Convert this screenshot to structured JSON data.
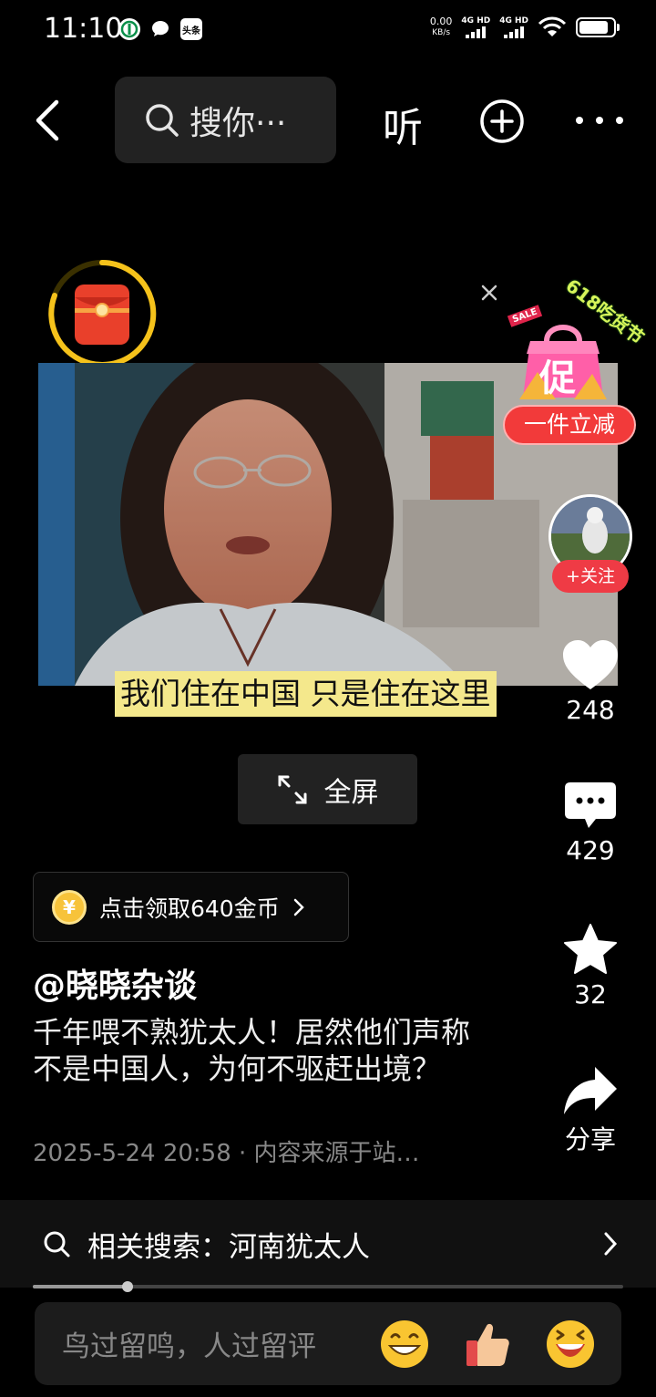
{
  "status_bar": {
    "time": "11:10",
    "net_speed_value": "0.00",
    "net_speed_unit": "KB/s",
    "sim1": "4G HD",
    "sim2": "4G HD",
    "battery_level": 0.85,
    "app_icons": [
      "bank-app-icon",
      "chat-app-icon",
      "toutiao-app-icon"
    ],
    "toutiao_label": "头条"
  },
  "top_nav": {
    "search_text": "搜你···",
    "listen_label": "听"
  },
  "video": {
    "subtitle": "我们住在中国 只是住在这里"
  },
  "promo": {
    "event_label": "618吃货节",
    "sale_tag": "SALE",
    "bag_label": "促",
    "pill_label": "一件立减"
  },
  "side_actions": {
    "follow_label": "+关注",
    "likes": "248",
    "comments": "429",
    "favorites": "32",
    "share_label": "分享"
  },
  "fullscreen_label": "全屏",
  "coin_reward": {
    "label": "点击领取640金币",
    "coin_symbol": "¥"
  },
  "post": {
    "author": "@晓晓杂谈",
    "description": "千年喂不熟犹太人！居然他们声称不是中国人，为何不驱赶出境？",
    "meta": "2025-5-24 20:58 · 内容来源于站…"
  },
  "related_search": {
    "label": "相关搜索：河南犹太人"
  },
  "playback_progress": 0.16,
  "comment_bar": {
    "placeholder": "鸟过留鸣，人过留评"
  },
  "colors": {
    "background": "#000000",
    "follow_red": "#ef3b45",
    "subtitle_yellow": "#f4e88c",
    "coin_gold": "#f7c33a",
    "redpacket_ring": "#f5c21b"
  }
}
